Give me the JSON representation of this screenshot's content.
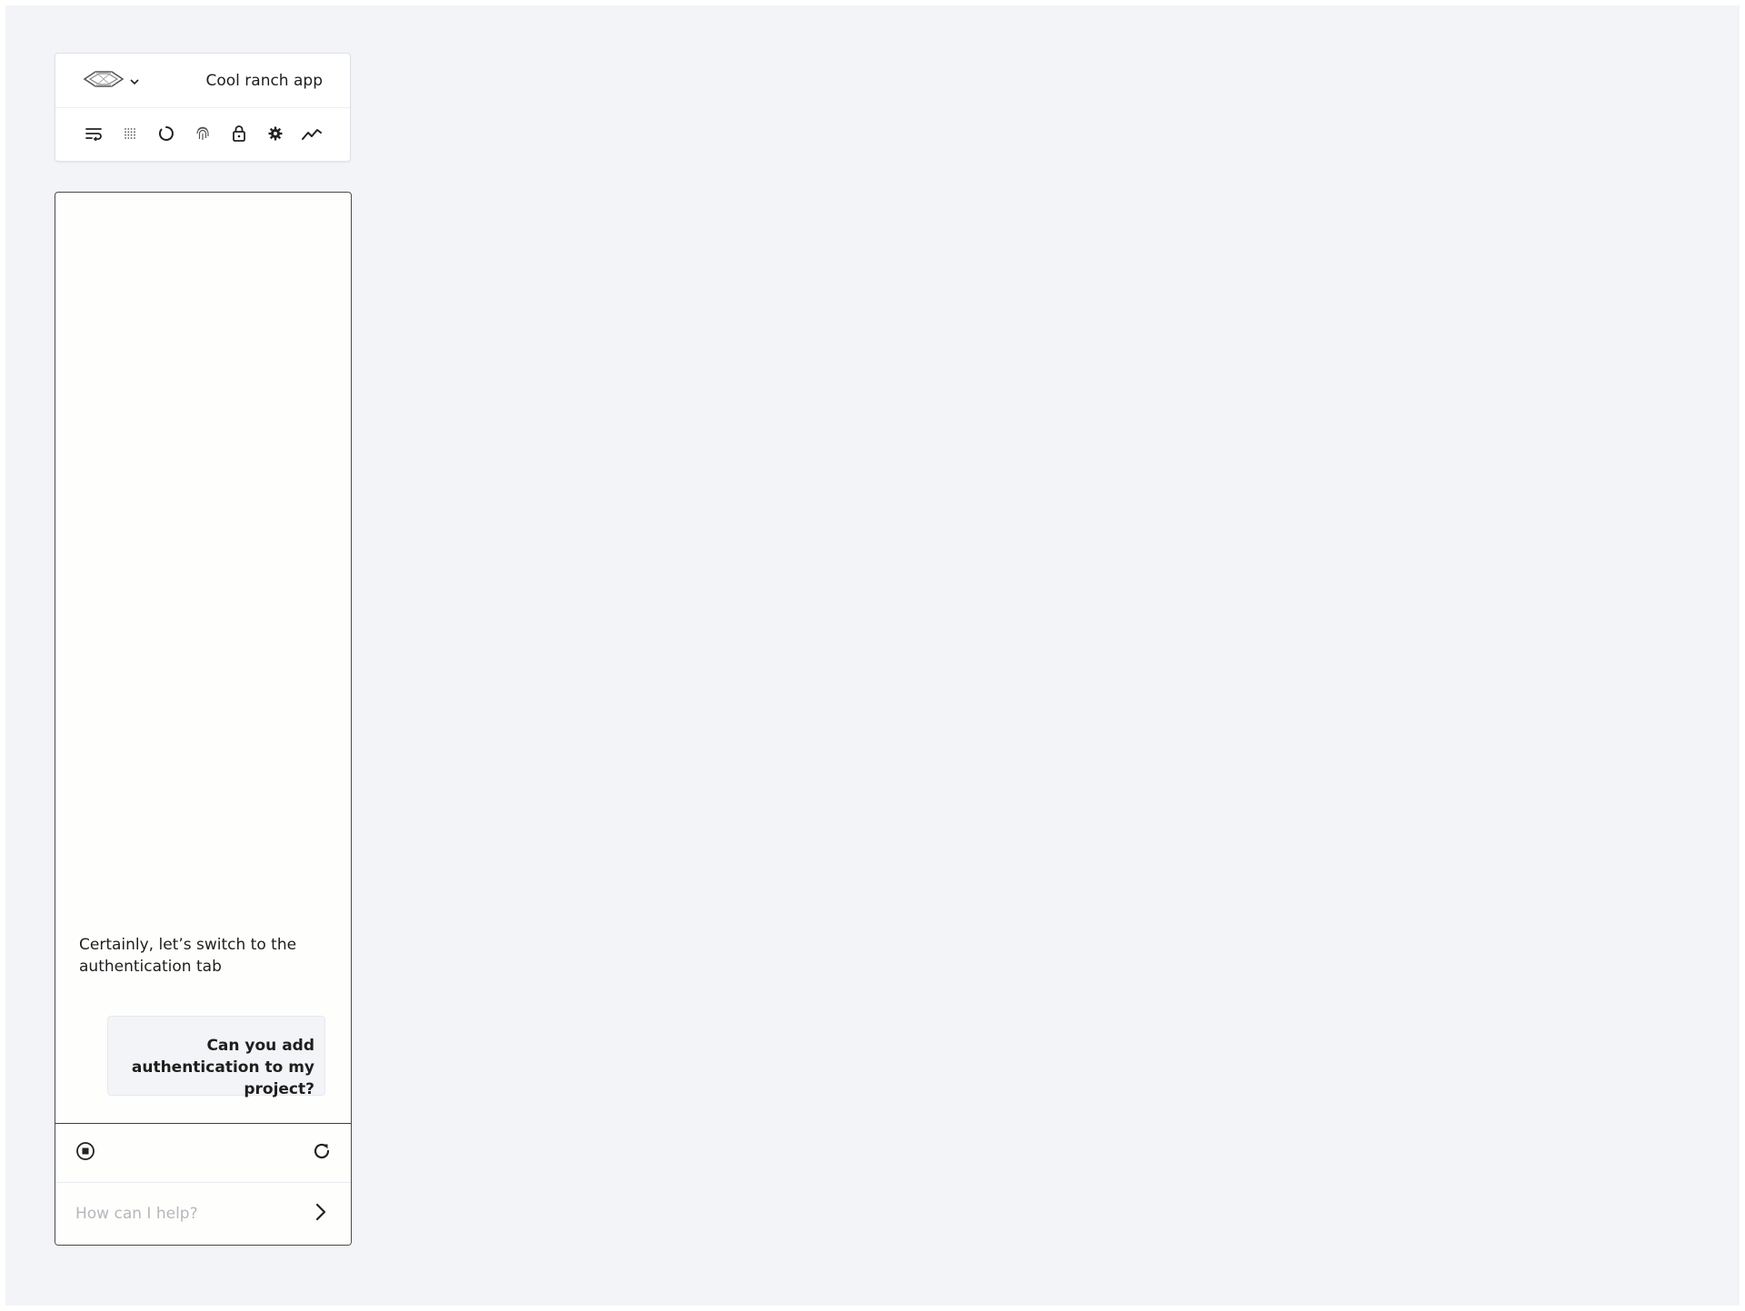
{
  "project": {
    "logo_icon": "logo-diamond-icon",
    "dropdown_icon": "chevron-down-icon",
    "name": "Cool ranch app"
  },
  "toolbar": {
    "tools": [
      {
        "id": "wrap",
        "icon": "text-wrap-icon"
      },
      {
        "id": "grid",
        "icon": "dot-grid-icon"
      },
      {
        "id": "loading",
        "icon": "circle-spinner-icon"
      },
      {
        "id": "fingerprint",
        "icon": "fingerprint-icon"
      },
      {
        "id": "lock",
        "icon": "lock-icon"
      },
      {
        "id": "settings",
        "icon": "gear-icon"
      },
      {
        "id": "analytics",
        "icon": "trend-line-icon"
      }
    ]
  },
  "chat": {
    "messages": [
      {
        "role": "assistant",
        "text": "Certainly, let’s switch to the authentication tab"
      },
      {
        "role": "user",
        "text": "Can you add authentication to my project?"
      }
    ],
    "controls": {
      "stop_icon": "stop-circle-icon",
      "refresh_icon": "refresh-icon"
    },
    "input": {
      "value": "",
      "placeholder": "How can I help?",
      "send_icon": "chevron-right-icon"
    }
  }
}
